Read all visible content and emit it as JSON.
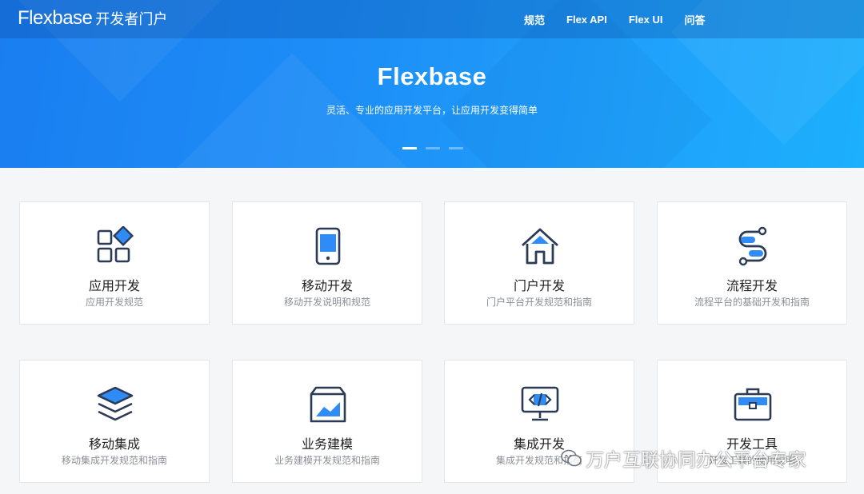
{
  "header": {
    "logo_word": "Flexbase",
    "logo_sub": "开发者门户",
    "nav": [
      "规范",
      "Flex API",
      "Flex UI",
      "问答"
    ]
  },
  "hero": {
    "title": "Flexbase",
    "subtitle": "灵活、专业的应用开发平台，让应用开发变得简单",
    "slides": 3,
    "active_slide": 0
  },
  "cards": [
    {
      "title": "应用开发",
      "desc": "应用开发规范",
      "icon": "app-grid-icon"
    },
    {
      "title": "移动开发",
      "desc": "移动开发说明和规范",
      "icon": "mobile-phone-icon"
    },
    {
      "title": "门户开发",
      "desc": "门户平台开发规范和指南",
      "icon": "home-icon"
    },
    {
      "title": "流程开发",
      "desc": "流程平台的基础开发和指南",
      "icon": "workflow-icon"
    },
    {
      "title": "移动集成",
      "desc": "移动集成开发规范和指南",
      "icon": "layers-icon"
    },
    {
      "title": "业务建模",
      "desc": "业务建模开发规范和指南",
      "icon": "chart-box-icon"
    },
    {
      "title": "集成开发",
      "desc": "集成开发规范和指南",
      "icon": "code-monitor-icon"
    },
    {
      "title": "开发工具",
      "desc": "开发工具的使用说明",
      "icon": "toolbox-icon"
    }
  ],
  "watermark": {
    "text": "万户互联协同办公平台专家"
  },
  "colors": {
    "accent": "#1e88f5",
    "icon_stroke": "#2b3a55",
    "icon_fill": "#2f8cf6"
  }
}
